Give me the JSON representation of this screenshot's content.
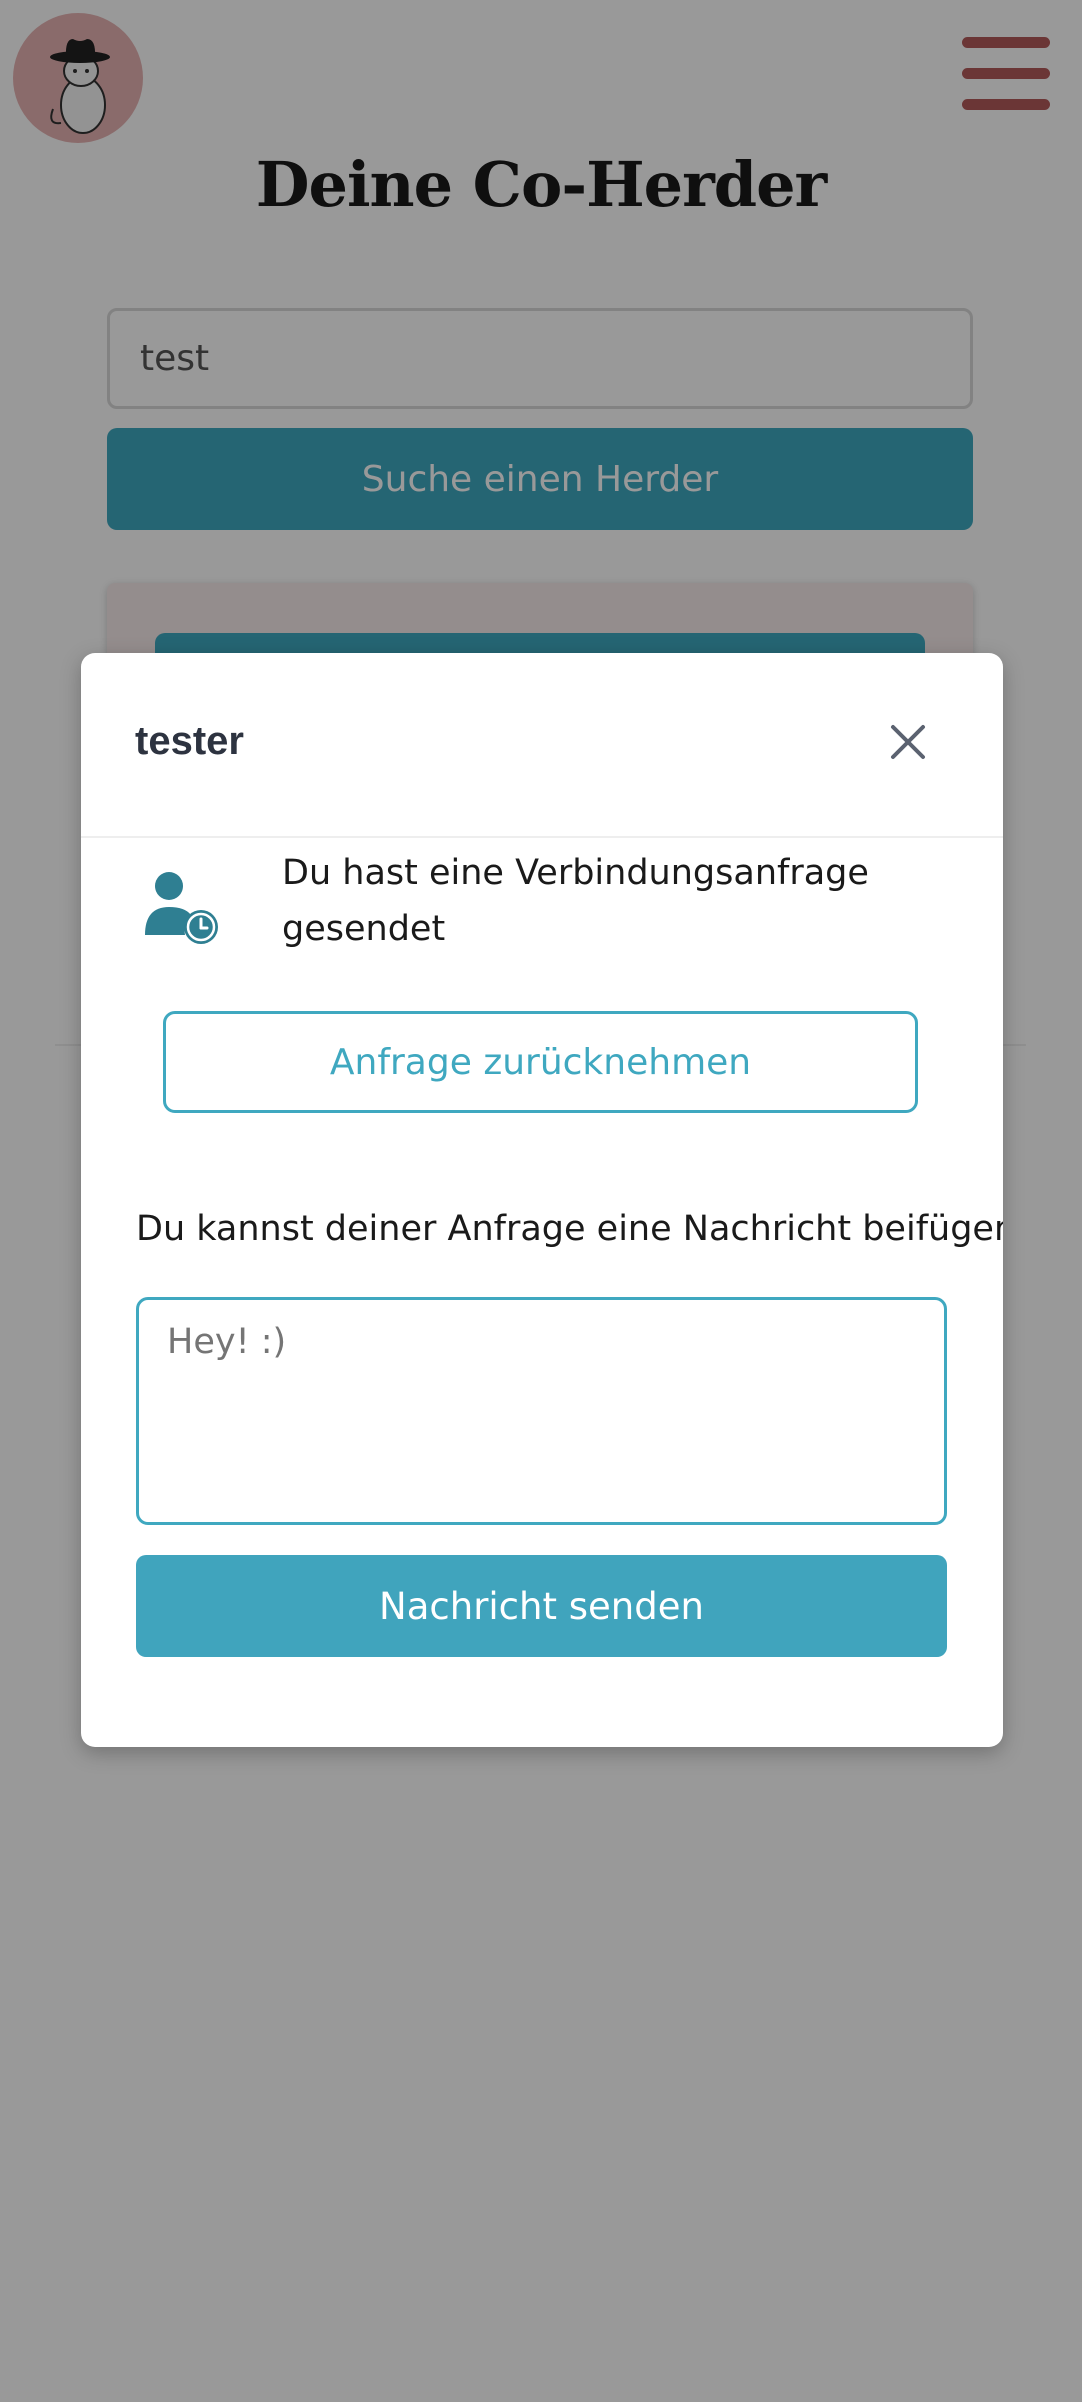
{
  "header": {
    "logo_icon": "cowboy-cat-logo",
    "menu_icon": "hamburger-menu-icon",
    "title": "Deine Co-Herder"
  },
  "search": {
    "value": "test",
    "button_label": "Suche einen Herder"
  },
  "modal": {
    "title": "tester",
    "close_icon": "close-icon",
    "status_icon": "user-clock-icon",
    "status_text": "Du hast eine Verbindungsanfrage gesendet",
    "withdraw_label": "Anfrage zurücknehmen",
    "message_label": "Du kannst deiner Anfrage eine Nachricht beifügen:",
    "message_placeholder": "Hey! :)",
    "send_label": "Nachricht senden"
  },
  "colors": {
    "accent": "#3fa8c0",
    "brand": "#b35a5a",
    "backdrop": "rgba(0,0,0,0.4)"
  }
}
